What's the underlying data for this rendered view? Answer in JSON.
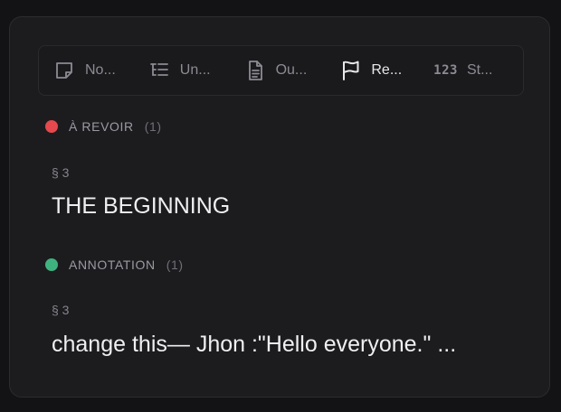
{
  "tabs": [
    {
      "label": "No...",
      "icon": "note-icon",
      "active": false
    },
    {
      "label": "Un...",
      "icon": "list-tree-icon",
      "active": false
    },
    {
      "label": "Ou...",
      "icon": "document-icon",
      "active": false
    },
    {
      "label": "Re...",
      "icon": "flag-icon",
      "active": true
    },
    {
      "num": "123",
      "label": "St...",
      "icon": "numbers-icon",
      "active": false
    }
  ],
  "sections": [
    {
      "title": "À REVOIR",
      "count": "(1)",
      "color": "#e5484d",
      "entries": [
        {
          "ref": "§ 3",
          "text": "THE BEGINNING"
        }
      ]
    },
    {
      "title": "ANNOTATION",
      "count": "(1)",
      "color": "#3fb37f",
      "entries": [
        {
          "ref": "§ 3",
          "text": "change this— Jhon :\"Hello everyone.\" ..."
        }
      ]
    }
  ]
}
